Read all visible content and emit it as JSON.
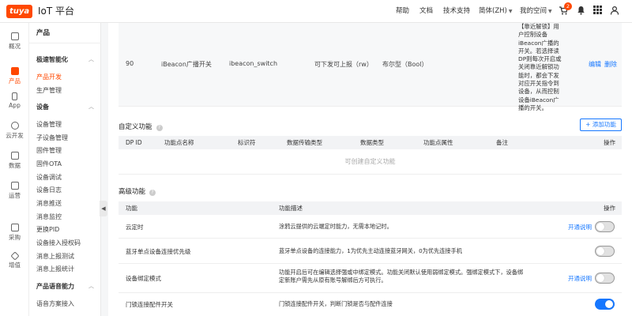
{
  "topbar": {
    "logo": "tuya",
    "platform": "IoT 平台",
    "help": "帮助",
    "docs": "文档",
    "tech_support": "技术支持",
    "language": "简体(ZH)",
    "my_space": "我的空间",
    "cart_badge": "2"
  },
  "leftnav": {
    "items": [
      {
        "label": "概况",
        "icon": "home-icon"
      },
      {
        "label": "产品",
        "icon": "box-icon"
      },
      {
        "label": "App",
        "icon": "phone-icon"
      },
      {
        "label": "云开发",
        "icon": "cloud-icon"
      },
      {
        "label": "数据",
        "icon": "chart-icon"
      },
      {
        "label": "运营",
        "icon": "document-icon"
      },
      {
        "label": "采购",
        "icon": "cart-icon"
      },
      {
        "label": "增值",
        "icon": "diamond-icon"
      }
    ]
  },
  "subnav": {
    "title": "产品",
    "group1": "极速智能化",
    "g1_items": [
      "产品开发",
      "生产管理"
    ],
    "group2": "设备",
    "g2_items": [
      "设备管理",
      "子设备管理",
      "固件管理",
      "固件OTA",
      "设备调试",
      "设备日志",
      "消息推送",
      "消息监控",
      "更换PID",
      "设备接入授权码",
      "消息上报测试",
      "消息上报统计"
    ],
    "group3": "产品语音能力",
    "g3_items": [
      "语音方案接入"
    ]
  },
  "dp_row": {
    "id": "90",
    "name": "iBeacon广播开关",
    "identifier": "ibeacon_switch",
    "transfer": "可下发可上报（rw）",
    "type": "布尔型（Bool）",
    "desc": "【靠近解锁】用户控制设备iBeacon广播的开关。若选择读DP则每次开启或关闭靠近解锁功能时，都会下发对应开关指令到设备，从而控制设备iBeacon广播的开关。",
    "edit": "编辑",
    "delete": "删除"
  },
  "custom": {
    "title": "自定义功能",
    "add_button": "+ 添加功能",
    "headers": [
      "DP ID",
      "功能点名称",
      "标识符",
      "数据传输类型",
      "数据类型",
      "功能点属性",
      "备注",
      "操作"
    ],
    "empty": "可创建自定义功能"
  },
  "advanced": {
    "title": "高级功能",
    "headers": {
      "feature": "功能",
      "desc": "功能描述",
      "action": "操作"
    },
    "rows": [
      {
        "name": "云定时",
        "desc": "涂鸦云提供的云端定时能力，无需本地记时。",
        "link": "开通说明",
        "on": false
      },
      {
        "name": "蓝牙单点设备连接优先级",
        "desc": "蓝牙单点设备的连接能力，1为优先主动连接蓝牙网关，0为优先连接手机",
        "link": "",
        "on": false
      },
      {
        "name": "设备绑定模式",
        "desc": "功能开启后可在编辑选择强或中绑定模式。功能关闭默认使用弱绑定模式。强绑定模式下，设备绑定新账户需先从原有账号解绑后方可执行。",
        "link": "开通说明",
        "on": false
      },
      {
        "name": "门锁连接配件开关",
        "desc": "门锁连接配件开关，判断门锁是否与配件连接",
        "link": "",
        "on": true
      }
    ]
  },
  "colors": {
    "brand": "#ff4800",
    "link": "#1677ff"
  }
}
